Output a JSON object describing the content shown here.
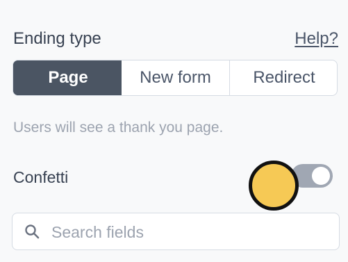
{
  "ending": {
    "label": "Ending type",
    "help_link": "Help?",
    "options": [
      {
        "label": "Page",
        "selected": true
      },
      {
        "label": "New form",
        "selected": false
      },
      {
        "label": "Redirect",
        "selected": false
      }
    ],
    "helper_text": "Users will see a thank you page."
  },
  "confetti": {
    "label": "Confetti",
    "enabled": false
  },
  "search": {
    "placeholder": "Search fields",
    "value": "",
    "icon": "search-icon"
  },
  "colors": {
    "active_segment": "#4b5563",
    "toggle_off": "#a0a7b3",
    "cursor_marker": "#f6c955"
  }
}
